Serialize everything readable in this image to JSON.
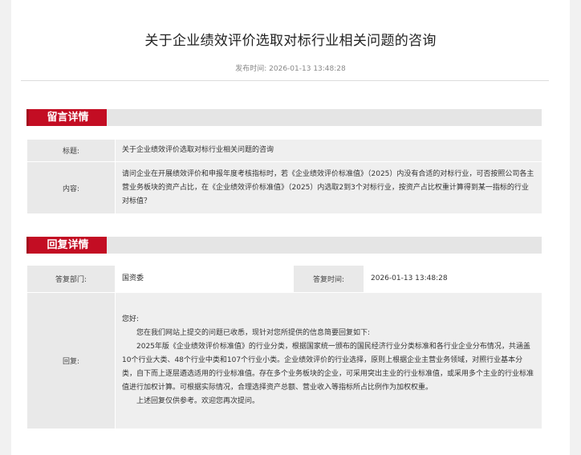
{
  "page": {
    "title": "关于企业绩效评价选取对标行业相关问题的咨询",
    "publish_label": "发布时间:",
    "publish_time": "2026-01-13 13:48:28"
  },
  "message_section": {
    "tab_label": "留言详情",
    "title_label": "标题:",
    "title_value": "关于企业绩效评价选取对标行业相关问题的咨询",
    "content_label": "内容:",
    "content_value": "请问企业在开展绩效评价和申报年度考核指标时，若《企业绩效评价标准值》（2025）内没有合适的对标行业，可否按照公司各主营业务板块的资产占比，在《企业绩效评价标准值》（2025）内选取2到3个对标行业，按资产占比权重计算得到某一指标的行业对标值？"
  },
  "reply_section": {
    "tab_label": "回复详情",
    "dept_label": "答复部门:",
    "dept_value": "国资委",
    "time_label": "答复时间:",
    "time_value": "2026-01-13 13:48:28",
    "reply_label": "回复:",
    "greeting": "您好:",
    "para1": "您在我们网站上提交的问题已收悉，现针对您所提供的信息简要回复如下:",
    "para2": "2025年版《企业绩效评价标准值》的行业分类，根据国家统一颁布的国民经济行业分类标准和各行业企业分布情况，共涵盖10个行业大类、48个行业中类和107个行业小类。企业绩效评价的行业选择，原则上根据企业主营业务领域，对照行业基本分类，自下而上逐层遴选适用的行业标准值。存在多个业务板块的企业，可采用突出主业的行业标准值，或采用多个主业的行业标准值进行加权计算。可根据实际情况，合理选择资产总额、营业收入等指标所占比例作为加权权重。",
    "para3": "上述回复仅供参考。欢迎您再次提问。"
  }
}
